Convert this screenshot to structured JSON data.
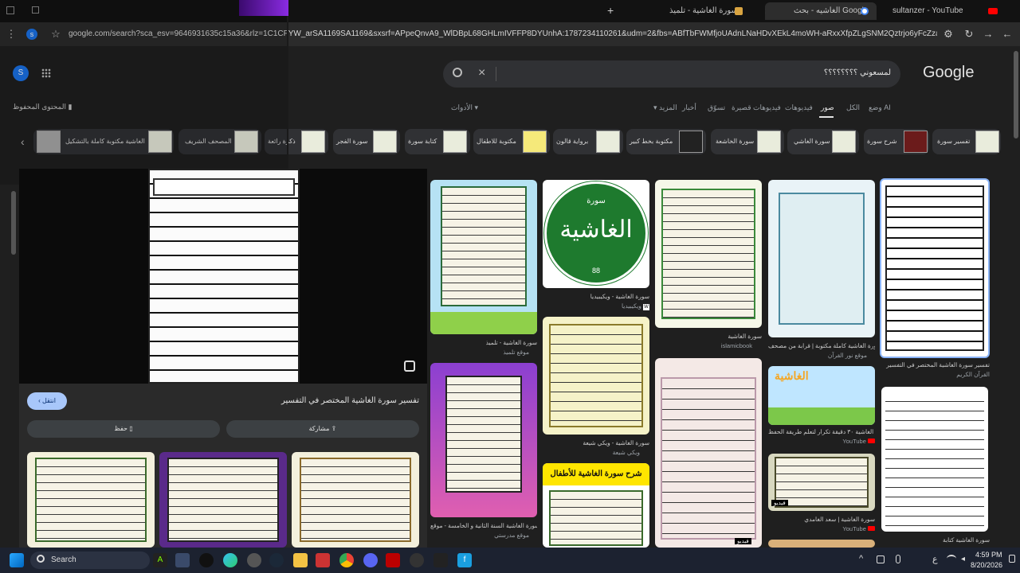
{
  "browser": {
    "tabs": [
      {
        "label": "sultanzer - YouTube"
      },
      {
        "label": "الغاشيه - بحث Google"
      },
      {
        "label": "سورة الغاشية - تلميذ"
      }
    ],
    "url": "google.com/search?sca_esv=9646931635c15a36&rlz=1C1CFYW_arSA1169SA1169&sxsrf=APpeQnvA9_WlDBpL68GHLmIVFFP8DYUnhA:1787234110261&udm=2&fbs=ABfTbFWMfjoUAdnLNaHDvXEkL4moWH-aRxxXfpZLgSNM2Qztrjo6yFcZzaDAsDv6XrN6sfarqJ7UC...",
    "profile_initial": "s"
  },
  "google": {
    "logo": "Google",
    "query": "لمسعوني ؟؟؟؟؟؟؟؟",
    "avatar_initial": "S",
    "saved_content": "المحتوى المحفوظ",
    "tabs": [
      {
        "label": "وضع AI"
      },
      {
        "label": "الكل"
      },
      {
        "label": "صور",
        "active": true
      },
      {
        "label": "فيديوهات"
      },
      {
        "label": "فيديوهات قصيرة"
      },
      {
        "label": "تسوّق"
      },
      {
        "label": "أخبار"
      },
      {
        "label": "المزيد"
      }
    ],
    "tools": "الأدوات",
    "chips": [
      {
        "label": "تفسير سورة"
      },
      {
        "label": "شرح سورة"
      },
      {
        "label": "سورة الغاشي"
      },
      {
        "label": "سورة الخاشعة"
      },
      {
        "label": "مكتوبة بخط كبير"
      },
      {
        "label": "برواية قالون"
      },
      {
        "label": "مكتوبة للاطفال"
      },
      {
        "label": "كتابة سورة"
      },
      {
        "label": "سورة الفجر"
      },
      {
        "label": "ذكرة رائعة"
      },
      {
        "label": "المصحف الشريف"
      },
      {
        "label": "الغاشية مكتوبة كاملة بالتشكيل"
      }
    ]
  },
  "preview": {
    "title": "تفسير سورة الغاشية المختصر في التفسير",
    "visit": "انتقل",
    "share": "مشاركة",
    "save": "حفظ"
  },
  "results": [
    {
      "caption": "تفسير سورة الغاشية المختصر في التفسير",
      "source": "القرآن الكريم"
    },
    {
      "caption": "سورة الغاشية كاملة مكتوبة | قرابة من مصحف...",
      "source": "موقع نور القرآن"
    },
    {
      "caption": "سورة الغاشية",
      "source": "islamicbook"
    },
    {
      "caption": "سورة الغاشية - ويكيبيديا",
      "source": "ويكيبيديا"
    },
    {
      "caption": "سورة الغاشية - تلميذ",
      "source": "موقع تلميذ"
    },
    {
      "caption": "سورة الغاشية ٣٠ دقيقة تكرار لتعلم طريقة الحفظ...",
      "source": "YouTube"
    },
    {
      "caption": "سورة الغاشية | سعد الغامدي",
      "source": "YouTube"
    },
    {
      "caption": "سورة الغاشية - ويكي شيعة",
      "source": "ويكي شيعة"
    },
    {
      "caption": "سورة الغاشية السنة الثانية و الخامسة - موقع...",
      "source": "موقع مدرستي"
    },
    {
      "caption": "سورة الغاشية كتابة",
      "source": ""
    }
  ],
  "tile_texts": {
    "circle_title": "سورة",
    "circle_name": "الغاشية",
    "circle_num": "88",
    "kids_title": "شرح سورة الغاشية للأطفال",
    "anim_title": "الغاشية",
    "video_badge": "فيديو"
  },
  "taskbar": {
    "search": "Search",
    "time": "4:59 PM",
    "date": "8/20/2026",
    "lang": "ع"
  }
}
